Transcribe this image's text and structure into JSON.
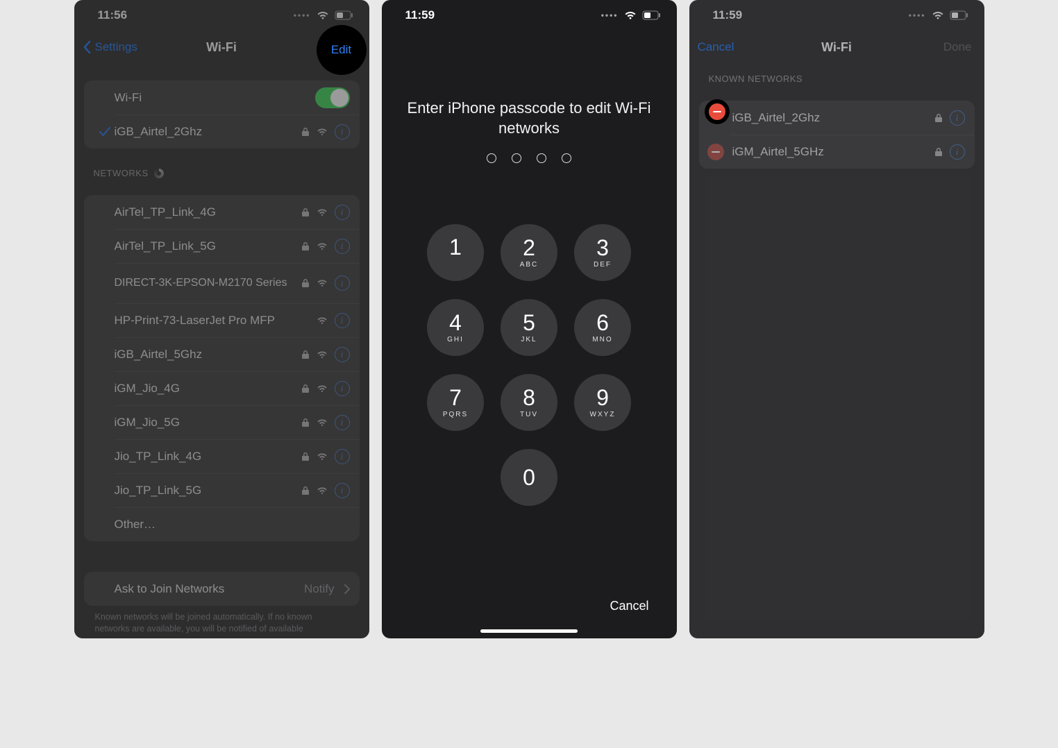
{
  "screen1": {
    "statusbar": {
      "time": "11:56"
    },
    "nav": {
      "back": "Settings",
      "title": "Wi-Fi",
      "edit": "Edit"
    },
    "wifi_toggle_label": "Wi-Fi",
    "connected": "iGB_Airtel_2Ghz",
    "networks_header": "NETWORKS",
    "networks": [
      {
        "name": "AirTel_TP_Link_4G",
        "locked": true
      },
      {
        "name": "AirTel_TP_Link_5G",
        "locked": true
      },
      {
        "name": "DIRECT-3K-EPSON-M2170 Series",
        "locked": true,
        "two": true
      },
      {
        "name": "HP-Print-73-LaserJet Pro MFP",
        "locked": false
      },
      {
        "name": "iGB_Airtel_5Ghz",
        "locked": true
      },
      {
        "name": "iGM_Jio_4G",
        "locked": true
      },
      {
        "name": "iGM_Jio_5G",
        "locked": true
      },
      {
        "name": "Jio_TP_Link_4G",
        "locked": true
      },
      {
        "name": "Jio_TP_Link_5G",
        "locked": true
      }
    ],
    "other": "Other…",
    "ask_label": "Ask to Join Networks",
    "ask_value": "Notify",
    "footnote": "Known networks will be joined automatically. If no known networks are available, you will be notified of available"
  },
  "screen2": {
    "statusbar": {
      "time": "11:59"
    },
    "prompt": "Enter iPhone passcode to edit Wi-Fi networks",
    "keys": [
      {
        "d": "1",
        "s": ""
      },
      {
        "d": "2",
        "s": "ABC"
      },
      {
        "d": "3",
        "s": "DEF"
      },
      {
        "d": "4",
        "s": "GHI"
      },
      {
        "d": "5",
        "s": "JKL"
      },
      {
        "d": "6",
        "s": "MNO"
      },
      {
        "d": "7",
        "s": "PQRS"
      },
      {
        "d": "8",
        "s": "TUV"
      },
      {
        "d": "9",
        "s": "WXYZ"
      },
      {
        "d": "0",
        "s": ""
      }
    ],
    "cancel": "Cancel"
  },
  "screen3": {
    "statusbar": {
      "time": "11:59"
    },
    "nav": {
      "cancel": "Cancel",
      "title": "Wi-Fi",
      "done": "Done"
    },
    "header": "KNOWN NETWORKS",
    "networks": [
      {
        "name": "iGB_Airtel_2Ghz"
      },
      {
        "name": "iGM_Airtel_5GHz"
      }
    ]
  }
}
